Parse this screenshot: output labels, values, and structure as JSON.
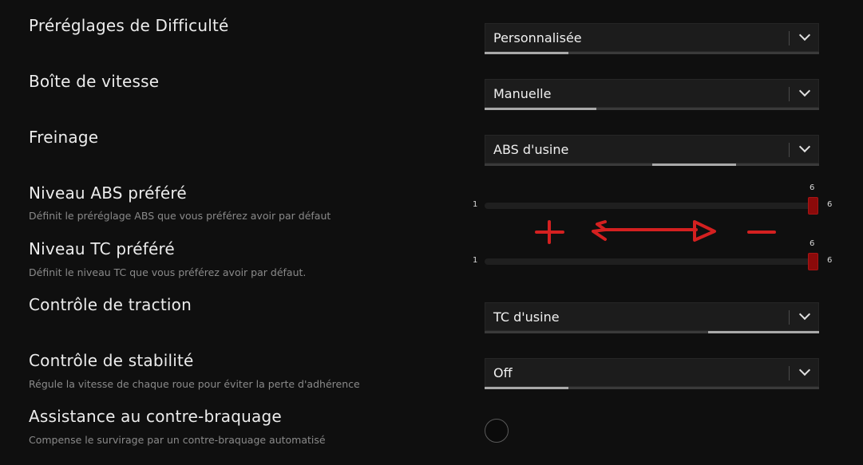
{
  "settings": {
    "difficulty": {
      "label": "Préréglages de Difficulté",
      "value": "Personnalisée",
      "level": 0.25
    },
    "gearbox": {
      "label": "Boîte de vitesse",
      "value": "Manuelle",
      "level": 0.33
    },
    "braking": {
      "label": "Freinage",
      "value": "ABS d'usine",
      "level_start": 0.5,
      "level_end": 0.75
    },
    "abs_level": {
      "label": "Niveau ABS préféré",
      "desc": "Définit le préréglage ABS que vous préférez avoir par défaut",
      "min": "1",
      "max": "6",
      "value": "6"
    },
    "tc_level": {
      "label": "Niveau TC préféré",
      "desc": "Définit le niveau TC que vous préférez avoir par défaut.",
      "min": "1",
      "max": "6",
      "value": "6"
    },
    "traction": {
      "label": "Contrôle de traction",
      "value": "TC d'usine",
      "level_start": 0.67,
      "level_end": 1.0
    },
    "stability": {
      "label": "Contrôle de stabilité",
      "desc": "Régule la vitesse de chaque roue pour éviter la perte d'adhérence",
      "value": "Off",
      "level": 0.25
    },
    "countersteer": {
      "label": "Assistance au contre-braquage",
      "desc": "Compense le survirage par un contre-braquage automatisé"
    }
  },
  "annotation": {
    "plus": "+",
    "minus": "−",
    "color": "#d42020"
  },
  "colors": {
    "background": "#0f0f0f",
    "dropdown": "#1c1c1c",
    "thumb": "#8b0a0a"
  }
}
